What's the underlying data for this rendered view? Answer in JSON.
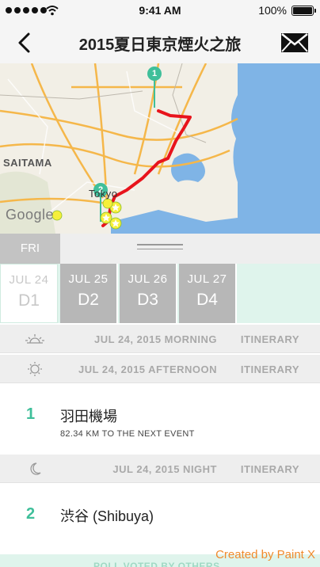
{
  "status_bar": {
    "time": "9:41 AM",
    "battery_percent": "100%",
    "signal_bars": 5,
    "icons": [
      "signal-dots-icon",
      "wifi-icon",
      "battery-icon"
    ]
  },
  "nav": {
    "title": "2015夏日東京煙火之旅",
    "back_icon": "chevron-left-icon",
    "action_icon": "envelope-icon"
  },
  "map": {
    "labels": {
      "saitama": "SAITAMA",
      "tokyo": "Tokyo",
      "attribution": "Google"
    },
    "pins": [
      {
        "label": "1"
      },
      {
        "label": "2"
      }
    ],
    "colors": {
      "route": "#e8141c",
      "water": "#7fb4e6",
      "land": "#f2efe6",
      "roads": "#f5b74a",
      "pin": "#3fbf9a"
    }
  },
  "day_strip": {
    "weekday": "FRI",
    "handle_icon": "drag-handle-icon"
  },
  "day_tabs": [
    {
      "date": "JUL 24",
      "day": "D1",
      "active": true
    },
    {
      "date": "JUL 25",
      "day": "D2",
      "active": false
    },
    {
      "date": "JUL 26",
      "day": "D3",
      "active": false
    },
    {
      "date": "JUL 27",
      "day": "D4",
      "active": false
    }
  ],
  "sections": {
    "morning": {
      "label": "JUL 24, 2015 MORNING",
      "link": "ITINERARY",
      "icon": "sunrise-icon"
    },
    "afternoon": {
      "label": "JUL 24, 2015 AFTERNOON",
      "link": "ITINERARY",
      "icon": "sun-icon"
    },
    "night": {
      "label": "JUL 24, 2015 NIGHT",
      "link": "ITINERARY",
      "icon": "moon-icon"
    }
  },
  "events": [
    {
      "num": "1",
      "title": "羽田機場",
      "sub": "82.34 KM TO THE NEXT EVENT"
    },
    {
      "num": "2",
      "title": "渋谷 (Shibuya)",
      "sub": ""
    }
  ],
  "bottom_partial": "POLL VOTED BY OTHERS",
  "watermark": "Created by Paint X",
  "accent_color": "#3fbf9a"
}
